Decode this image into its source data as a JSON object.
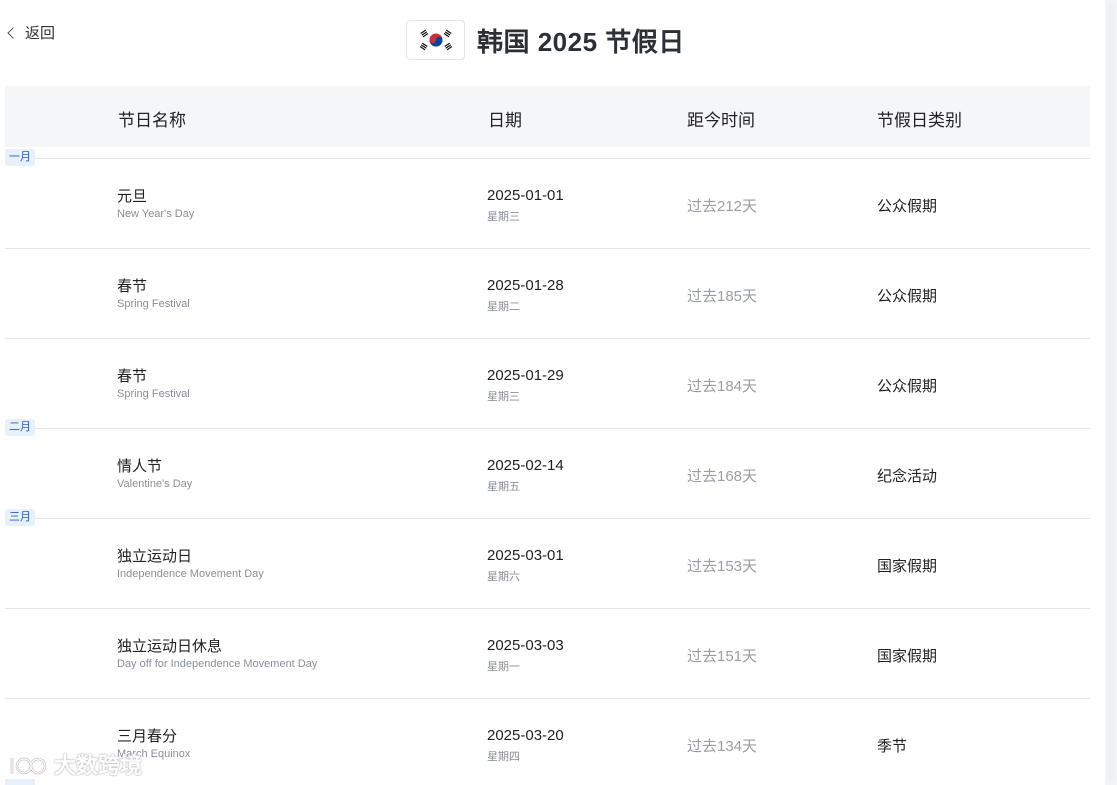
{
  "nav": {
    "back_label": "返回"
  },
  "header": {
    "title": "韩国 2025 节假日"
  },
  "table": {
    "columns": [
      "节日名称",
      "日期",
      "距今时间",
      "节假日类别"
    ],
    "rows": [
      {
        "name": "元旦",
        "name_en": "New Year's Day",
        "date": "2025-01-01",
        "weekday": "星期三",
        "since": "过去212天",
        "type": "公众假期"
      },
      {
        "name": "春节",
        "name_en": "Spring Festival",
        "date": "2025-01-28",
        "weekday": "星期二",
        "since": "过去185天",
        "type": "公众假期"
      },
      {
        "name": "春节",
        "name_en": "Spring Festival",
        "date": "2025-01-29",
        "weekday": "星期三",
        "since": "过去184天",
        "type": "公众假期"
      },
      {
        "name": "情人节",
        "name_en": "Valentine's Day",
        "date": "2025-02-14",
        "weekday": "星期五",
        "since": "过去168天",
        "type": "纪念活动"
      },
      {
        "name": "独立运动日",
        "name_en": "Independence Movement Day",
        "date": "2025-03-01",
        "weekday": "星期六",
        "since": "过去153天",
        "type": "国家假期"
      },
      {
        "name": "独立运动日休息",
        "name_en": "Day off for Independence Movement Day",
        "date": "2025-03-03",
        "weekday": "星期一",
        "since": "过去151天",
        "type": "国家假期"
      },
      {
        "name": "三月春分",
        "name_en": "March Equinox",
        "date": "2025-03-20",
        "weekday": "星期四",
        "since": "过去134天",
        "type": "季节"
      }
    ],
    "month_tags": [
      "一月",
      "二月",
      "三月"
    ]
  },
  "watermark": {
    "text": "大数跨境"
  }
}
